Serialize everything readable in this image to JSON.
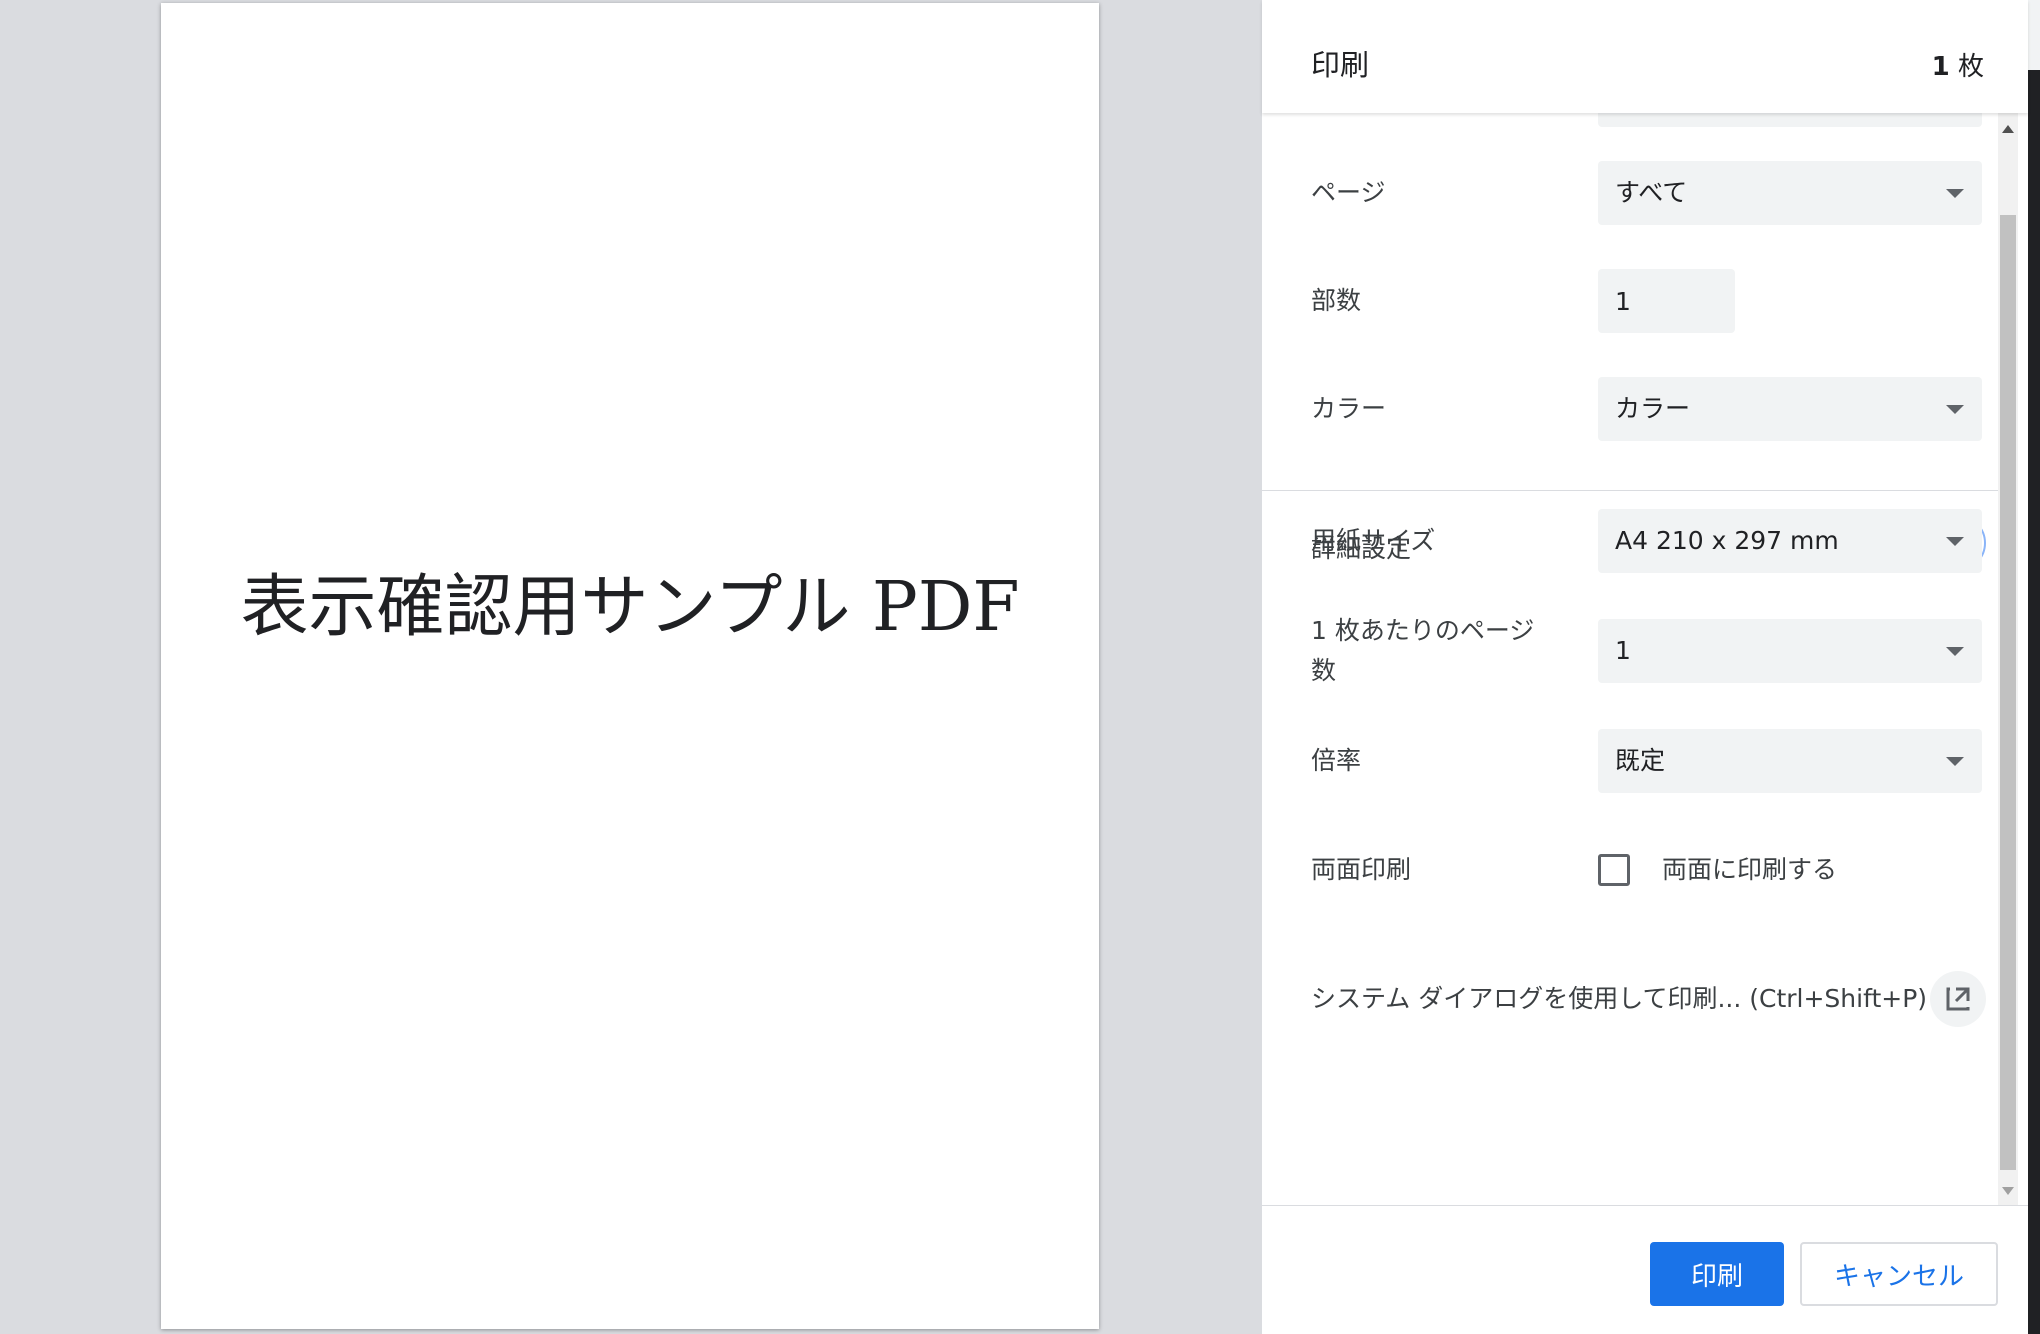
{
  "preview": {
    "page_text": "表示確認用サンプル PDF"
  },
  "header": {
    "title": "印刷",
    "sheet_count_number": "1",
    "sheet_count_unit": "枚"
  },
  "settings": {
    "pages": {
      "label": "ページ",
      "value": "すべて"
    },
    "copies": {
      "label": "部数",
      "value": "1"
    },
    "color": {
      "label": "カラー",
      "value": "カラー"
    },
    "advanced": {
      "label": "詳細設定"
    },
    "paper_size": {
      "label": "用紙サイズ",
      "value": "A4 210 x 297 mm"
    },
    "pages_per_sheet": {
      "label_line1": "1 枚あたりのページ",
      "label_line2": "数",
      "value": "1"
    },
    "scale": {
      "label": "倍率",
      "value": "既定"
    },
    "duplex": {
      "label": "両面印刷",
      "checkbox_label": "両面に印刷する",
      "checked": false
    },
    "system_dialog": {
      "label": "システム ダイアログを使用して印刷... (Ctrl+Shift+P)"
    }
  },
  "footer": {
    "print_label": "印刷",
    "cancel_label": "キャンセル"
  },
  "icons": {
    "dropdown": "caret-down-icon",
    "advanced_toggle": "chevron-up-icon",
    "system_dialog": "open-in-new-icon"
  },
  "colors": {
    "accent": "#1a73e8",
    "field_bg": "#f1f3f4",
    "preview_bg": "#dadce0"
  }
}
